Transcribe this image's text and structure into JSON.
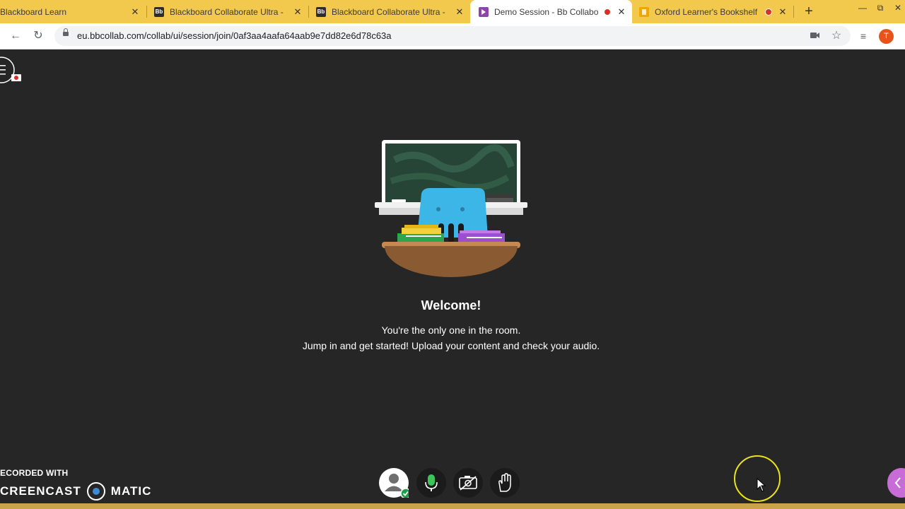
{
  "browser": {
    "tabs": [
      {
        "title": "Blackboard Learn",
        "favicon": "blackboard-icon",
        "recording": false,
        "active": false
      },
      {
        "title": "Blackboard Collaborate Ultra - ",
        "favicon": "bb-icon",
        "recording": false,
        "active": false
      },
      {
        "title": "Blackboard Collaborate Ultra - ",
        "favicon": "bb-icon",
        "recording": false,
        "active": false
      },
      {
        "title": "Demo Session - Bb Collabo",
        "favicon": "collaborate-icon",
        "recording": true,
        "active": true
      },
      {
        "title": "Oxford Learner's Bookshelf",
        "favicon": "oxford-icon",
        "recording": true,
        "active": false
      }
    ],
    "tab_close": "✕",
    "new_tab": "+",
    "url": "eu.bbcollab.com/collab/ui/session/join/0af3aa4aafa64aab9e7dd82e6d78c63a",
    "profile_initial": "T",
    "accent_color": "#f2c94c"
  },
  "session": {
    "welcome_title": "Welcome!",
    "line1": "You're the only one in the room.",
    "line2": "Jump in and get started! Upload your content and check your audio."
  },
  "controls": [
    {
      "name": "my-status-button",
      "icon": "avatar-icon"
    },
    {
      "name": "microphone-button",
      "icon": "microphone-icon"
    },
    {
      "name": "camera-button",
      "icon": "camera-off-icon"
    },
    {
      "name": "raise-hand-button",
      "icon": "hand-icon"
    }
  ],
  "watermark": {
    "line1": "ECORDED WITH",
    "line2_left": "CREENCAST",
    "line2_right": "MATIC"
  }
}
